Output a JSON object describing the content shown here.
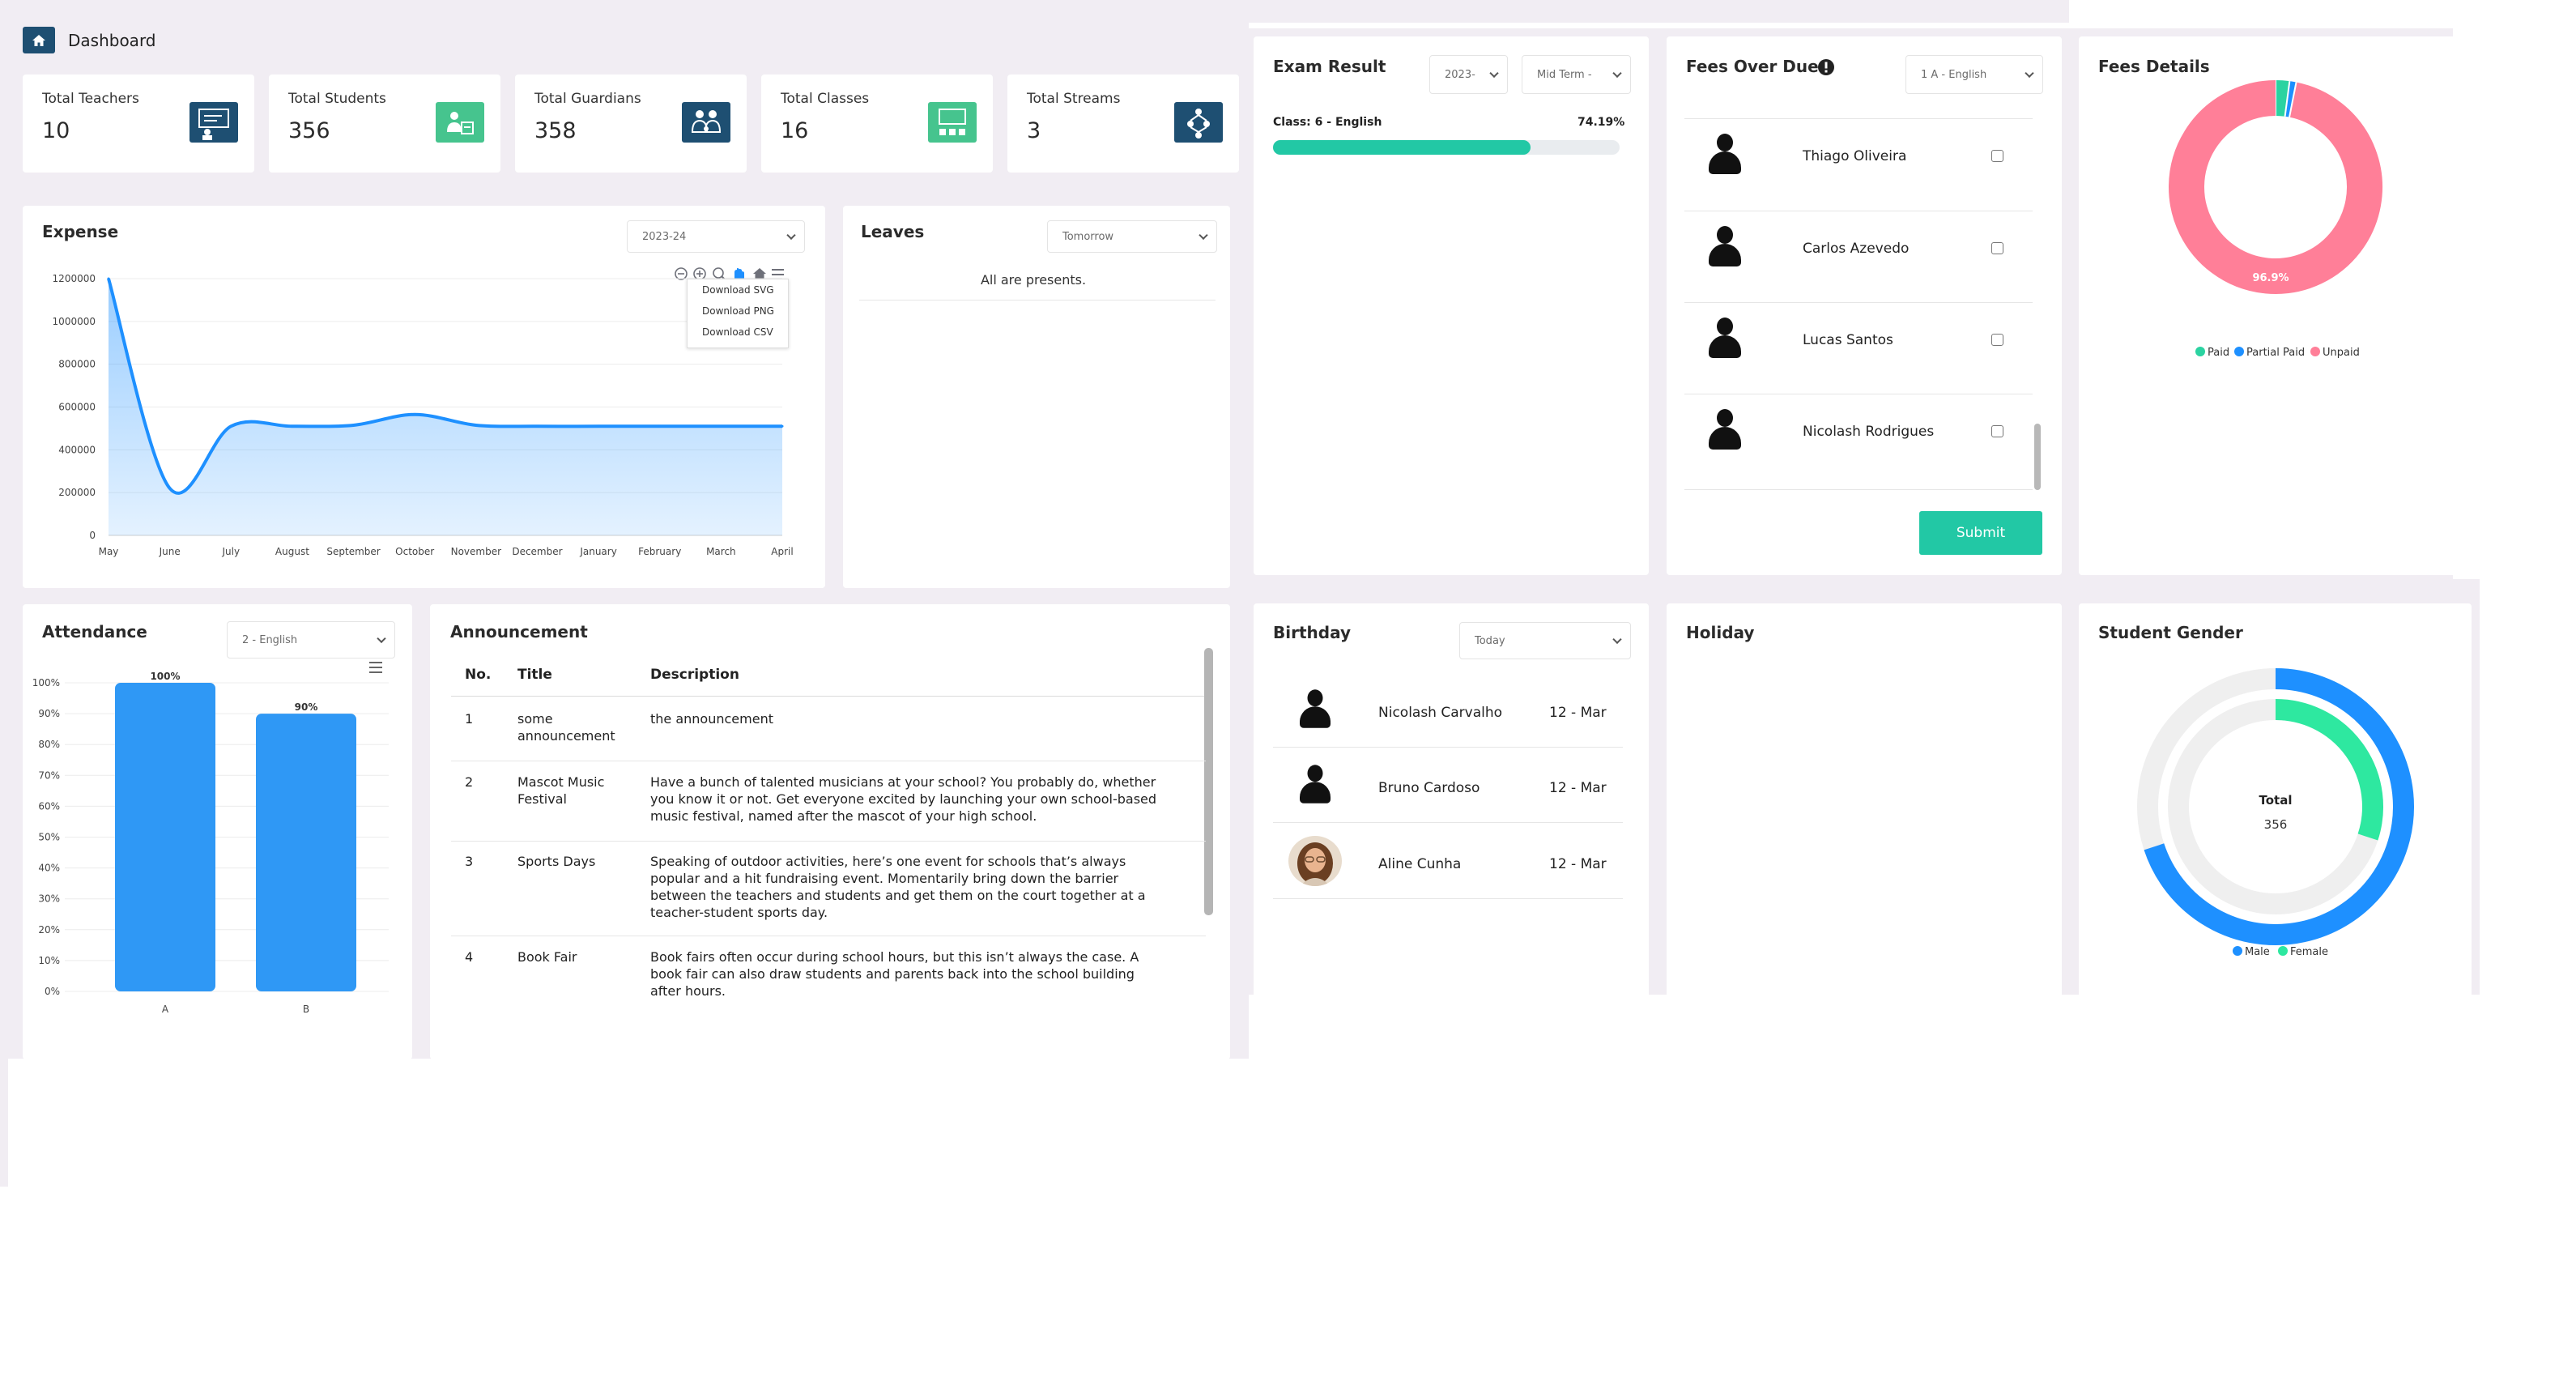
{
  "header": {
    "title": "Dashboard"
  },
  "stats": [
    {
      "label": "Total Teachers",
      "value": "10",
      "icon": "teacher-board-icon",
      "color": "#1e4f72"
    },
    {
      "label": "Total Students",
      "value": "356",
      "icon": "students-icon",
      "color": "#46c48e"
    },
    {
      "label": "Total Guardians",
      "value": "358",
      "icon": "guardians-icon",
      "color": "#1e4f72"
    },
    {
      "label": "Total Classes",
      "value": "16",
      "icon": "classroom-icon",
      "color": "#46c48e"
    },
    {
      "label": "Total Streams",
      "value": "3",
      "icon": "streams-icon",
      "color": "#1e4f72"
    }
  ],
  "expense": {
    "title": "Expense",
    "year_select": "2023-24",
    "menu": [
      "Download SVG",
      "Download PNG",
      "Download CSV"
    ]
  },
  "leaves": {
    "title": "Leaves",
    "select": "Tomorrow",
    "message": "All are presents."
  },
  "exam": {
    "title": "Exam Result",
    "year_select": "2023-",
    "term_select": "Mid Term -",
    "class_label": "Class: 6 - English",
    "percent_text": "74.19%",
    "percent": 74.19
  },
  "fees_overdue": {
    "title": "Fees Over Due",
    "select": "1 A - English",
    "students": [
      "Thiago Oliveira",
      "Carlos Azevedo",
      "Lucas Santos",
      "Nicolash Rodrigues"
    ],
    "submit": "Submit"
  },
  "fees_details": {
    "title": "Fees Details",
    "center_label": "96.9%",
    "legend": [
      "Paid",
      "Partial Paid",
      "Unpaid"
    ],
    "colors": {
      "paid": "#2bd3a1",
      "partial": "#1e90ff",
      "unpaid": "#ff7f98"
    }
  },
  "attendance": {
    "title": "Attendance",
    "select": "2 - English"
  },
  "announcement": {
    "title": "Announcement",
    "columns": [
      "No.",
      "Title",
      "Description"
    ],
    "rows": [
      {
        "no": "1",
        "title_lines": [
          "some",
          "announcement"
        ],
        "desc_lines": [
          "the announcement"
        ]
      },
      {
        "no": "2",
        "title_lines": [
          "Mascot Music",
          "Festival"
        ],
        "desc_lines": [
          "Have a bunch of talented musicians at your school? You probably do, whether",
          "you know it or not. Get everyone excited by launching your own school-based",
          "music festival, named after the mascot of your high school."
        ]
      },
      {
        "no": "3",
        "title_lines": [
          "Sports Days"
        ],
        "desc_lines": [
          "Speaking of outdoor activities, here’s one event for schools that’s always",
          "popular and a hit fundraising event. Momentarily bring down the barrier",
          "between the teachers and students and get them on the court together at a",
          "teacher-student sports day."
        ]
      },
      {
        "no": "4",
        "title_lines": [
          "Book Fair"
        ],
        "desc_lines": [
          "Book fairs often occur during school hours, but this isn’t always the case. A",
          "book fair can also draw students and parents back into the school building",
          "after hours."
        ]
      }
    ]
  },
  "birthday": {
    "title": "Birthday",
    "select": "Today",
    "people": [
      {
        "name": "Nicolash Carvalho",
        "date": "12 - Mar"
      },
      {
        "name": "Bruno Cardoso",
        "date": "12 - Mar"
      },
      {
        "name": "Aline Cunha",
        "date": "12 - Mar"
      }
    ]
  },
  "holiday": {
    "title": "Holiday"
  },
  "gender": {
    "title": "Student Gender",
    "center_title": "Total",
    "center_value": "356",
    "legend": [
      "Male",
      "Female"
    ],
    "colors": {
      "male": "#1e90ff",
      "female": "#2ee8a0"
    }
  },
  "chart_data": [
    {
      "type": "area",
      "categories": [
        "May",
        "June",
        "July",
        "August",
        "September",
        "October",
        "November",
        "December",
        "January",
        "February",
        "March",
        "April"
      ],
      "values": [
        1200000,
        220000,
        510000,
        510000,
        515000,
        565000,
        515000,
        510000,
        510000,
        510000,
        510000,
        510000
      ],
      "y_ticks": [
        "1200000",
        "1000000",
        "800000",
        "600000",
        "400000",
        "200000",
        "0"
      ],
      "ylim": [
        0,
        1200000
      ],
      "color": "#1e90ff"
    },
    {
      "type": "bar",
      "categories": [
        "A",
        "B"
      ],
      "values": [
        100,
        90
      ],
      "data_labels": [
        "100%",
        "90%"
      ],
      "y_ticks": [
        "100%",
        "90%",
        "80%",
        "70%",
        "60%",
        "50%",
        "40%",
        "30%",
        "20%",
        "10%",
        "0%"
      ],
      "ylim": [
        0,
        100
      ],
      "color": "#2f98f5"
    },
    {
      "type": "pie",
      "categories": [
        "Paid",
        "Partial Paid",
        "Unpaid"
      ],
      "values": [
        2.1,
        1.0,
        96.9
      ]
    },
    {
      "type": "pie",
      "categories": [
        "Male",
        "Female"
      ],
      "values": [
        249,
        107
      ]
    }
  ]
}
